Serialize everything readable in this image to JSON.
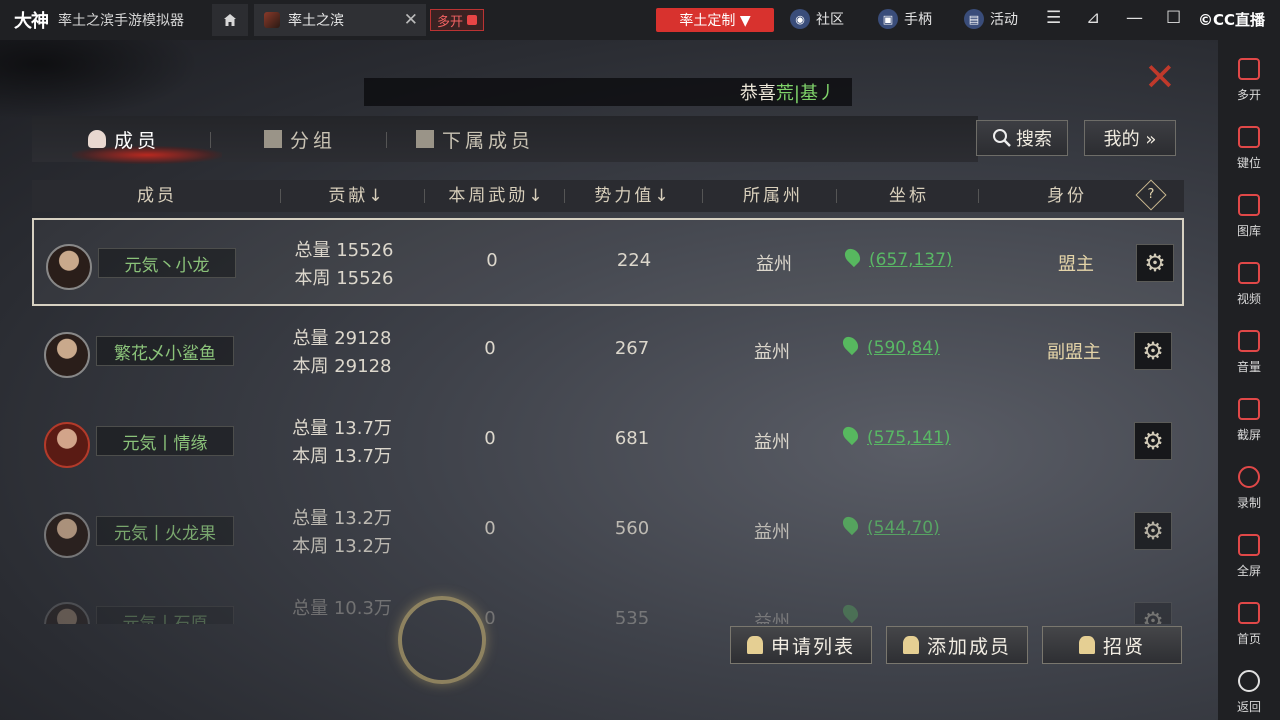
{
  "titlebar": {
    "logo": "大神",
    "app_title": "率土之滨手游模拟器",
    "tab_title": "率土之滨",
    "tab_close": "✕",
    "multi_label": "多开",
    "custom_label": "率土定制 ▼",
    "links": [
      {
        "label": "社区",
        "icon": "community-icon"
      },
      {
        "label": "手柄",
        "icon": "gamepad-icon"
      },
      {
        "label": "活动",
        "icon": "activity-icon"
      }
    ],
    "cc_logo": "©CC直播"
  },
  "game": {
    "notice_prefix": "恭喜",
    "notice_highlight": "荒|基丿",
    "tabs": [
      {
        "label": "成员",
        "active": true
      },
      {
        "label": "分组",
        "active": false
      },
      {
        "label": "下属成员",
        "active": false
      }
    ],
    "search_label": "搜索",
    "mine_label": "我的 »",
    "columns": [
      "成员",
      "贡献↓",
      "本周武勋↓",
      "势力值↓",
      "所属州",
      "坐标",
      "身份"
    ],
    "help_label": "?",
    "rows": [
      {
        "name": "元気丶小龙",
        "total": "总量 15526",
        "week": "本周 15526",
        "merit": "0",
        "power": "224",
        "state": "益州",
        "coord": "(657,137)",
        "role": "盟主",
        "selected": true
      },
      {
        "name": "繁花乄小鲨鱼",
        "total": "总量 29128",
        "week": "本周 29128",
        "merit": "0",
        "power": "267",
        "state": "益州",
        "coord": "(590,84)",
        "role": "副盟主",
        "selected": false
      },
      {
        "name": "元気丨情缘",
        "total": "总量 13.7万",
        "week": "本周 13.7万",
        "merit": "0",
        "power": "681",
        "state": "益州",
        "coord": "(575,141)",
        "role": "",
        "selected": false
      },
      {
        "name": "元気丨火龙果",
        "total": "总量 13.2万",
        "week": "本周 13.2万",
        "merit": "0",
        "power": "560",
        "state": "益州",
        "coord": "(544,70)",
        "role": "",
        "selected": false
      },
      {
        "name": "元気丨石原",
        "total": "总量 10.3万",
        "week": "",
        "merit": "0",
        "power": "535",
        "state": "益州",
        "coord": "",
        "role": "",
        "selected": false
      }
    ],
    "bottom_buttons": [
      {
        "label": "申请列表"
      },
      {
        "label": "添加成员"
      },
      {
        "label": "招贤"
      }
    ],
    "colors": {
      "accent_red": "#d8322e",
      "name_green": "#8bc37a",
      "coord_green": "#59b865",
      "role_gold": "#e4d4a8"
    }
  },
  "sidebar": {
    "items": [
      {
        "label": "多开",
        "icon": "multi-open-icon"
      },
      {
        "label": "键位",
        "icon": "keyboard-icon"
      },
      {
        "label": "图库",
        "icon": "gallery-icon"
      },
      {
        "label": "视频",
        "icon": "video-icon"
      },
      {
        "label": "音量",
        "icon": "volume-icon"
      },
      {
        "label": "截屏",
        "icon": "screenshot-icon"
      },
      {
        "label": "录制",
        "icon": "record-icon"
      },
      {
        "label": "全屏",
        "icon": "fullscreen-icon"
      },
      {
        "label": "首页",
        "icon": "home-icon"
      },
      {
        "label": "返回",
        "icon": "back-icon"
      }
    ]
  }
}
